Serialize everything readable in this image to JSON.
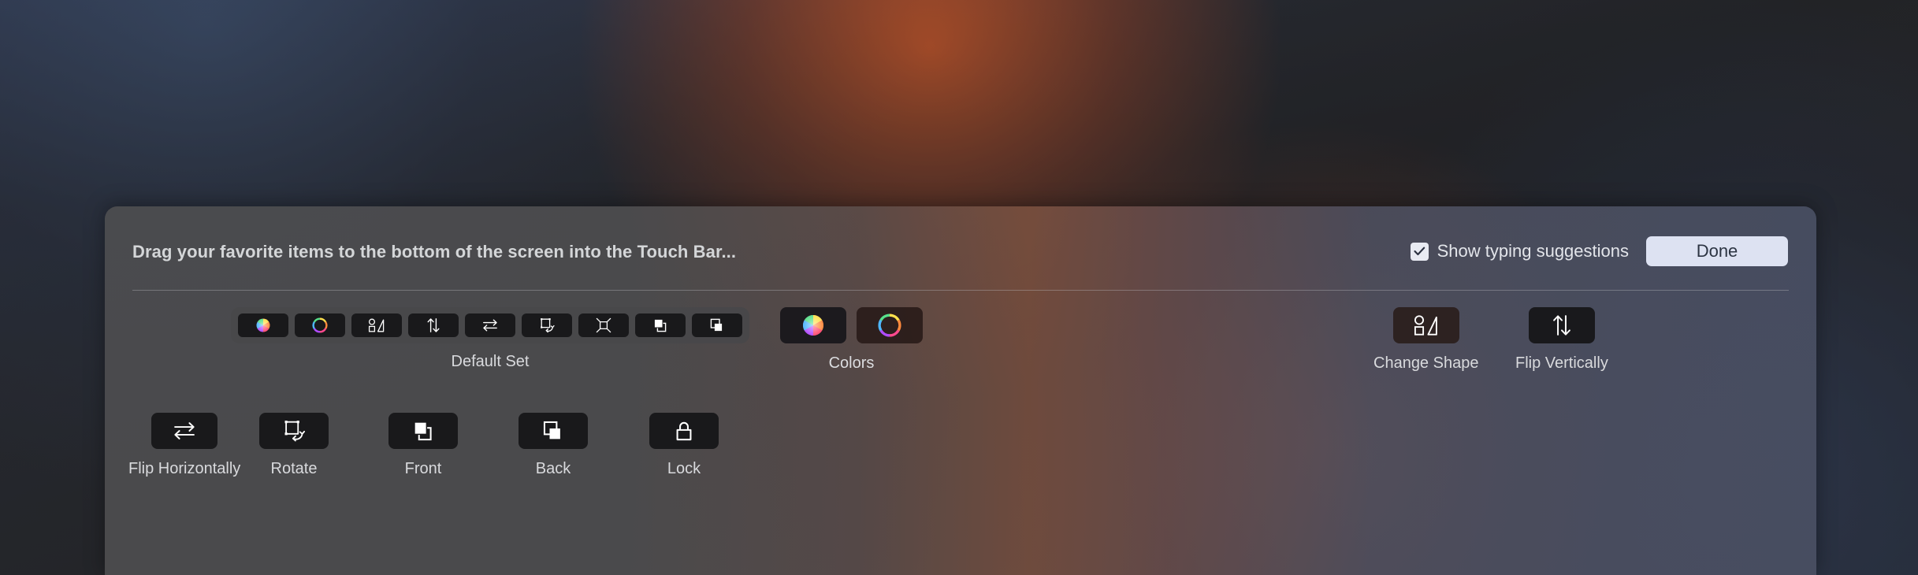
{
  "window": {
    "kind": "touch-bar-customization-sheet",
    "title": "Drag your favorite items to the bottom of the screen into the Touch Bar...",
    "panel_bg": "#4e4e50",
    "accent": "#dde2f2"
  },
  "header": {
    "title": "Drag your favorite items to the bottom of the screen into the Touch Bar...",
    "checkbox": {
      "label": "Show typing suggestions",
      "checked": true,
      "box_color": "#e8eaf2",
      "check_color": "#2a3040"
    },
    "done_label": "Done"
  },
  "default_set": {
    "caption": "Default Set",
    "items": [
      {
        "icon": "color-wheel-filled-icon",
        "name": "colors-filled"
      },
      {
        "icon": "color-wheel-ring-icon",
        "name": "colors-ring"
      },
      {
        "icon": "change-shape-icon",
        "name": "change-shape"
      },
      {
        "icon": "flip-vertically-icon",
        "name": "flip-vertically"
      },
      {
        "icon": "flip-horizontally-icon",
        "name": "flip-horizontally"
      },
      {
        "icon": "rotate-icon",
        "name": "rotate"
      },
      {
        "icon": "resize-icon",
        "name": "resize"
      },
      {
        "icon": "front-icon",
        "name": "front"
      },
      {
        "icon": "back-icon",
        "name": "back"
      }
    ]
  },
  "palette": {
    "row_top": [
      {
        "label": "Colors",
        "icon": "color-wheel-pair-icon",
        "tiles": 2
      },
      {
        "label": "Change Shape",
        "icon": "change-shape-icon",
        "tiles": 1
      },
      {
        "label": "Flip Vertically",
        "icon": "flip-vertically-icon",
        "tiles": 1
      }
    ],
    "row_bottom": [
      {
        "label": "Flip Horizontally",
        "icon": "flip-horizontally-icon",
        "tiles": 1
      },
      {
        "label": "Rotate",
        "icon": "rotate-icon",
        "tiles": 1
      },
      {
        "label": "Front",
        "icon": "front-icon",
        "tiles": 1
      },
      {
        "label": "Back",
        "icon": "back-icon",
        "tiles": 1
      },
      {
        "label": "Lock",
        "icon": "lock-icon",
        "tiles": 1
      }
    ]
  }
}
